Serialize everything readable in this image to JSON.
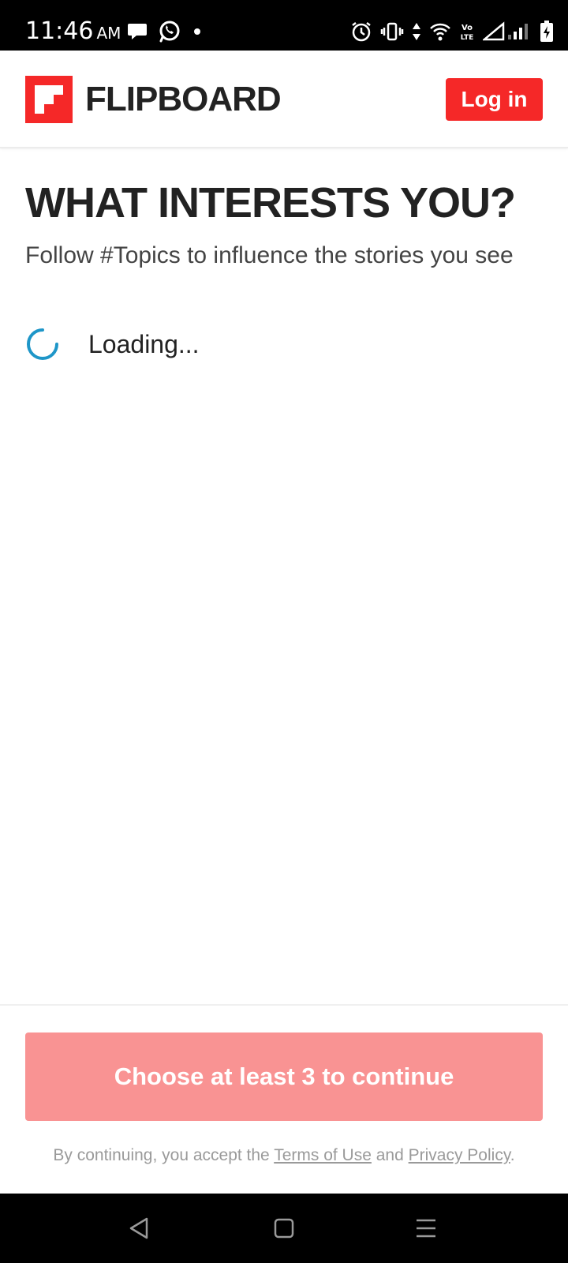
{
  "status_bar": {
    "time": "11:46",
    "ampm": "AM",
    "left_icons": [
      "message-bubble-icon",
      "whatsapp-icon",
      "notification-dot-icon"
    ],
    "right_icons": [
      "alarm-icon",
      "vibrate-icon",
      "data-arrows-icon",
      "wifi-icon",
      "volte-icon",
      "signal-icon",
      "battery-charging-icon"
    ],
    "volte_label": "Vo LTE"
  },
  "header": {
    "logo_text": "FLIPBOARD",
    "login_label": "Log in"
  },
  "main": {
    "title": "WHAT INTERESTS YOU?",
    "subtitle": "Follow #Topics to influence the stories you see",
    "loading_text": "Loading..."
  },
  "footer": {
    "continue_label": "Choose at least 3 to continue",
    "legal_prefix": "By continuing, you accept the ",
    "terms_label": "Terms of Use",
    "legal_and": " and ",
    "privacy_label": "Privacy Policy",
    "legal_suffix": "."
  },
  "nav_bar": {
    "buttons": [
      "back-icon",
      "home-icon",
      "recents-menu-icon"
    ]
  },
  "colors": {
    "brand_red": "#f52828",
    "disabled_red": "#f99393",
    "spinner_blue": "#1e96c8",
    "title_text": "#222222"
  }
}
